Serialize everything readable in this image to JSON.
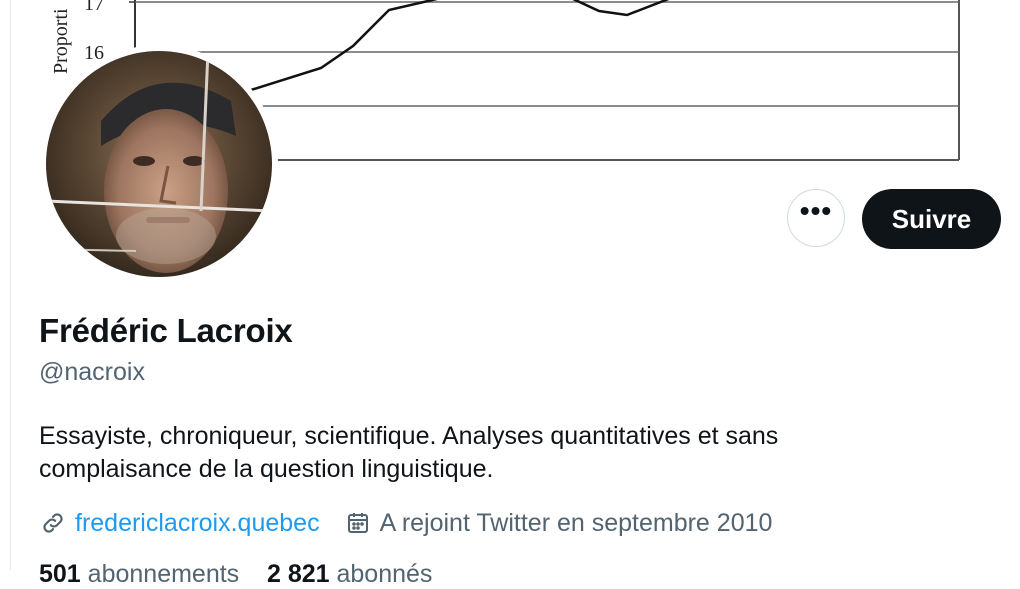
{
  "banner": {
    "y_axis_label": "Proporti",
    "tick_17": "17",
    "tick_16": "16"
  },
  "profile": {
    "name": "Frédéric Lacroix",
    "handle": "@nacroix",
    "bio_line1": "Essayiste, chroniqueur, scientifique. Analyses quantitatives et sans",
    "bio_line2": "complaisance de la question linguistique.",
    "website": "fredericlacroix.quebec",
    "joined": "A rejoint Twitter en septembre 2010"
  },
  "actions": {
    "more_label": "•••",
    "follow_label": "Suivre"
  },
  "stats": {
    "following_count": "501",
    "following_label": "abonnements",
    "followers_count": "2 821",
    "followers_label": "abonnés"
  },
  "icons": {
    "link": "link-icon",
    "calendar": "calendar-icon",
    "more": "more-icon"
  },
  "colors": {
    "accent": "#1d9bf0",
    "text": "#0f1419",
    "secondary": "#536471",
    "button_bg": "#0f1419"
  }
}
